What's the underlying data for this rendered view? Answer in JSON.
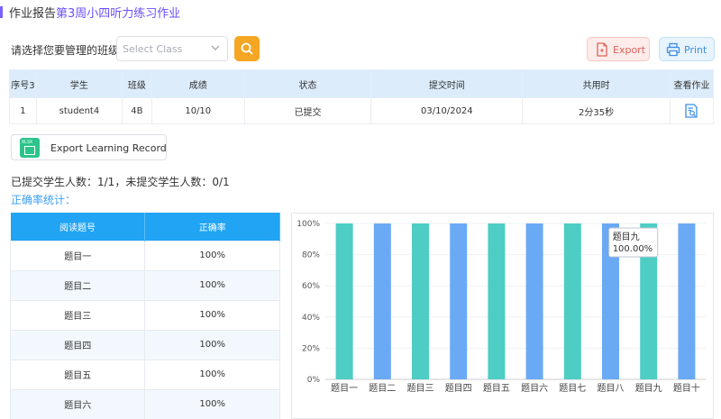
{
  "header": {
    "title_prefix": "作业报告",
    "title_accent": "第3周小四听力练习作业"
  },
  "class_select": {
    "label": "请选择您要管理的班级：",
    "placeholder": "Select Class"
  },
  "toolbar": {
    "export_label": "Export",
    "print_label": "Print"
  },
  "records": {
    "headers": [
      "序号3",
      "学生",
      "班级",
      "成绩",
      "状态",
      "提交时间",
      "共用时",
      "查看作业"
    ],
    "rows": [
      {
        "index": "1",
        "student": "student4",
        "class": "4B",
        "score": "10/10",
        "status": "已提交",
        "submitted": "03/10/2024",
        "duration": "2分35秒"
      }
    ]
  },
  "export_record": {
    "badge": "XLSX",
    "label": "Export Learning Record"
  },
  "summary": {
    "counts": "已提交学生人数：1/1，未提交学生人数：0/1",
    "stats_label": "正确率统计："
  },
  "accuracy_table": {
    "headers": [
      "阅读题号",
      "正确率"
    ],
    "rows": [
      {
        "q": "题目一",
        "rate": "100%"
      },
      {
        "q": "题目二",
        "rate": "100%"
      },
      {
        "q": "题目三",
        "rate": "100%"
      },
      {
        "q": "题目四",
        "rate": "100%"
      },
      {
        "q": "题目五",
        "rate": "100%"
      },
      {
        "q": "题目六",
        "rate": "100%"
      }
    ]
  },
  "colors": {
    "accent": "#6b4dff",
    "bar_teal": "#4ecdc4",
    "bar_blue": "#6aaaf5",
    "table_header": "#20a4f3"
  },
  "chart_data": {
    "type": "bar",
    "categories": [
      "题目一",
      "题目二",
      "题目三",
      "题目四",
      "题目五",
      "题目六",
      "题目七",
      "题目八",
      "题目九",
      "题目十"
    ],
    "values": [
      100,
      100,
      100,
      100,
      100,
      100,
      100,
      100,
      100,
      100
    ],
    "ylim": [
      0,
      100
    ],
    "yticks": [
      "0%",
      "20%",
      "40%",
      "60%",
      "80%",
      "100%"
    ],
    "grid": true,
    "tooltip": {
      "category": "题目九",
      "value": "100.00%"
    }
  }
}
